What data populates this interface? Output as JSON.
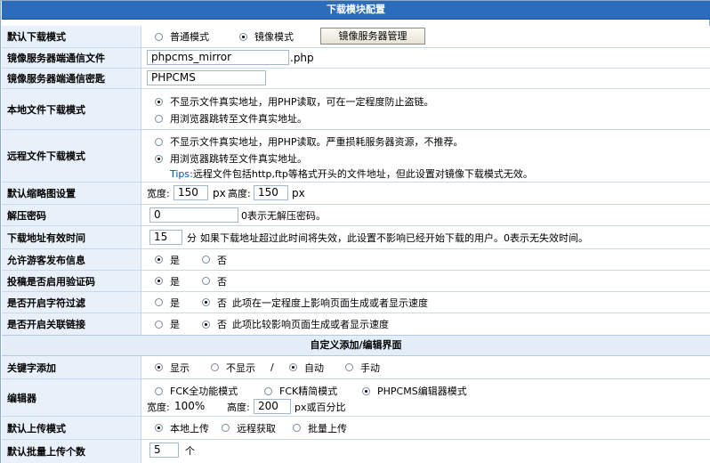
{
  "header": {
    "title": "下载模块配置"
  },
  "rows": {
    "download_mode": {
      "label": "默认下载模式",
      "opt_normal": "普通模式",
      "opt_mirror": "镜像模式",
      "mirror_btn": "镜像服务器管理"
    },
    "mirror_file": {
      "label": "镜像服务器端通信文件",
      "value": "phpcms_mirror",
      "suffix": ".php"
    },
    "mirror_key": {
      "label": "镜像服务器端通信密匙",
      "value": "PHPCMS"
    },
    "local_mode": {
      "label": "本地文件下载模式",
      "opt1": "不显示文件真实地址，用PHP读取，可在一定程度防止盗链。",
      "opt2": "用浏览器跳转至文件真实地址。"
    },
    "remote_mode": {
      "label": "远程文件下载模式",
      "opt1": "不显示文件真实地址，用PHP读取。严重损耗服务器资源，不推荐。",
      "opt2": "用浏览器跳转至文件真实地址。",
      "tips_prefix": "Tips:",
      "tips_text": "远程文件包括http,ftp等格式开头的文件地址，但此设置对镜像下载模式无效。"
    },
    "thumb": {
      "label": "默认缩略图设置",
      "width_label": "宽度:",
      "width": "150",
      "unit1": "px",
      "height_label": "高度:",
      "height": "150",
      "unit2": "px"
    },
    "unzip": {
      "label": "解压密码",
      "value": "0",
      "hint": "0表示无解压密码。"
    },
    "valid_time": {
      "label": "下载地址有效时间",
      "value": "15",
      "unit": "分",
      "hint": "如果下载地址超过此时间将失效，此设置不影响已经开始下载的用户。0表示无失效时间。"
    },
    "guest_post": {
      "label": "允许游客发布信息",
      "yes": "是",
      "no": "否"
    },
    "captcha": {
      "label": "投稿是否启用验证码",
      "yes": "是",
      "no": "否"
    },
    "char_filter": {
      "label": "是否开启字符过滤",
      "yes": "是",
      "no": "否",
      "note": "此项在一定程度上影响页面生成或者显示速度"
    },
    "related_link": {
      "label": "是否开启关联链接",
      "yes": "是",
      "no": "否",
      "note": "此项比较影响页面生成或者显示速度"
    }
  },
  "section2": {
    "title": "自定义添加/编辑界面"
  },
  "rows2": {
    "keyword": {
      "label": "关键字添加",
      "show": "显示",
      "hide": "不显示",
      "sep": "/",
      "auto": "自动",
      "manual": "手动"
    },
    "editor": {
      "label": "编辑器",
      "opt1": "FCK全功能模式",
      "opt2": "FCK精简模式",
      "opt3": "PHPCMS编辑器模式",
      "width_label": "宽度:",
      "width": "100%",
      "height_label": "高度:",
      "height": "200",
      "unit": "px或百分比"
    },
    "upload_mode": {
      "label": "默认上传模式",
      "opt1": "本地上传",
      "opt2": "远程获取",
      "opt3": "批量上传"
    },
    "batch_count": {
      "label": "默认批量上传个数",
      "value": "5",
      "unit": "个"
    }
  }
}
